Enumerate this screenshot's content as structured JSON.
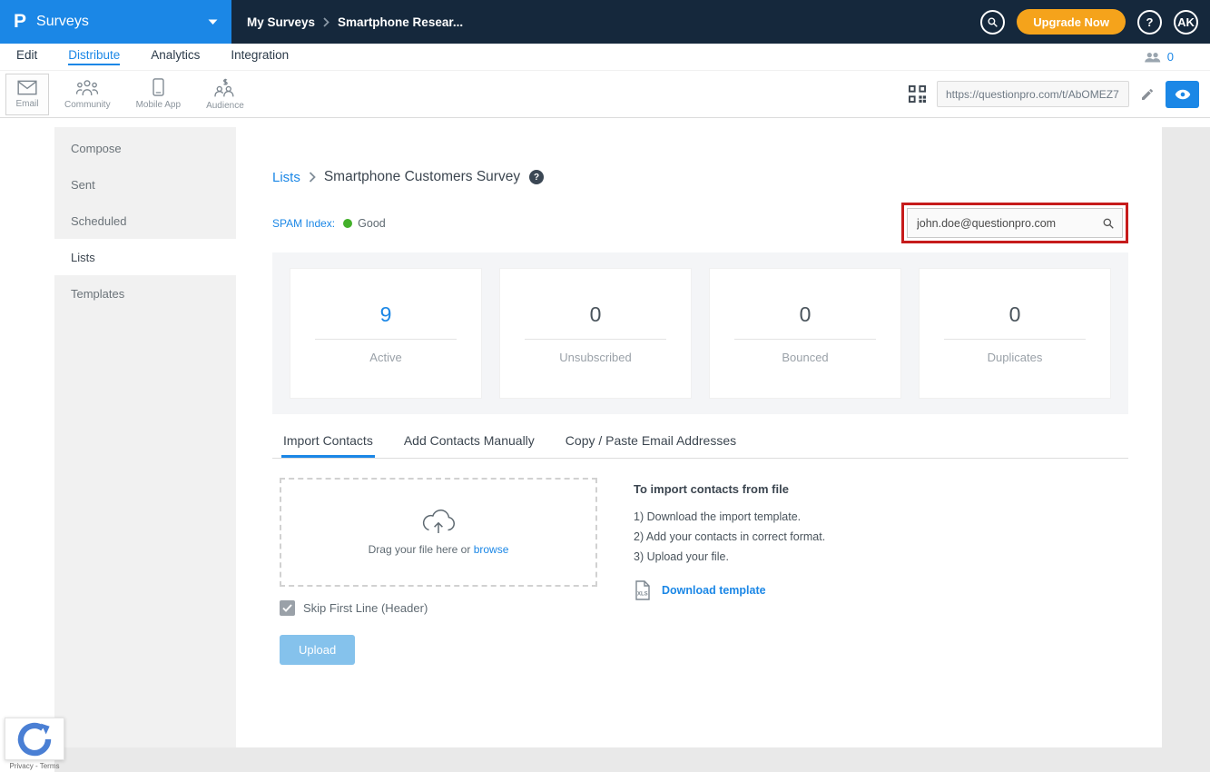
{
  "colors": {
    "accent_blue": "#1b87e6",
    "header_bg": "#15283c",
    "upgrade_orange": "#f5a31b",
    "spam_green": "#43b02a",
    "annotation_red": "#c61b1b",
    "upload_button_blue": "#85c2ec"
  },
  "header": {
    "logo_glyph": "P",
    "app_name": "Surveys",
    "breadcrumb": [
      "My Surveys",
      "Smartphone Resear..."
    ],
    "upgrade_label": "Upgrade Now",
    "help_glyph": "?",
    "avatar_initials": "AK"
  },
  "nav": {
    "tabs": [
      "Edit",
      "Distribute",
      "Analytics",
      "Integration"
    ],
    "active_tab": "Distribute",
    "collaborators_count": "0"
  },
  "toolbar": {
    "channels": [
      "Email",
      "Community",
      "Mobile App",
      "Audience"
    ],
    "active_channel": "Email",
    "share_url": "https://questionpro.com/t/AbOMEZ7"
  },
  "sidebar": {
    "items": [
      "Compose",
      "Sent",
      "Scheduled",
      "Lists",
      "Templates"
    ],
    "active_item": "Lists"
  },
  "main": {
    "breadcrumb": {
      "parent": "Lists",
      "current": "Smartphone Customers Survey",
      "help_glyph": "?"
    },
    "spam": {
      "label": "SPAM Index:",
      "value": "Good"
    },
    "search": {
      "value": "john.doe@questionpro.com"
    },
    "stats": [
      {
        "value": "9",
        "label": "Active"
      },
      {
        "value": "0",
        "label": "Unsubscribed"
      },
      {
        "value": "0",
        "label": "Bounced"
      },
      {
        "value": "0",
        "label": "Duplicates"
      }
    ],
    "tabs": [
      "Import Contacts",
      "Add Contacts Manually",
      "Copy / Paste Email Addresses"
    ],
    "active_tab": "Import Contacts",
    "dropzone": {
      "drag_text": "Drag your file here or",
      "browse_label": "browse"
    },
    "skip_first_line_label": "Skip First Line (Header)",
    "upload_button_label": "Upload",
    "instructions": {
      "title": "To import contacts from file",
      "steps": [
        "1) Download the import template.",
        "2) Add your contacts in correct format.",
        "3) Upload your file."
      ],
      "xls_label": "XLS",
      "download_label": "Download template"
    }
  },
  "recaptcha": {
    "privacy_label": "Privacy",
    "separator": "-",
    "terms_label": "Terms"
  },
  "icon_names": [
    "questionpro-logo",
    "dropdown-caret-icon",
    "chevron-right-icon",
    "search-icon",
    "help-icon",
    "avatar",
    "collaborators-icon",
    "email-icon",
    "community-icon",
    "mobile-app-icon",
    "audience-icon",
    "qr-code-icon",
    "edit-pencil-icon",
    "preview-eye-icon",
    "spam-status-dot",
    "search-field-icon",
    "upload-cloud-icon",
    "xls-file-icon",
    "checkbox-check-icon",
    "recaptcha-logo"
  ]
}
